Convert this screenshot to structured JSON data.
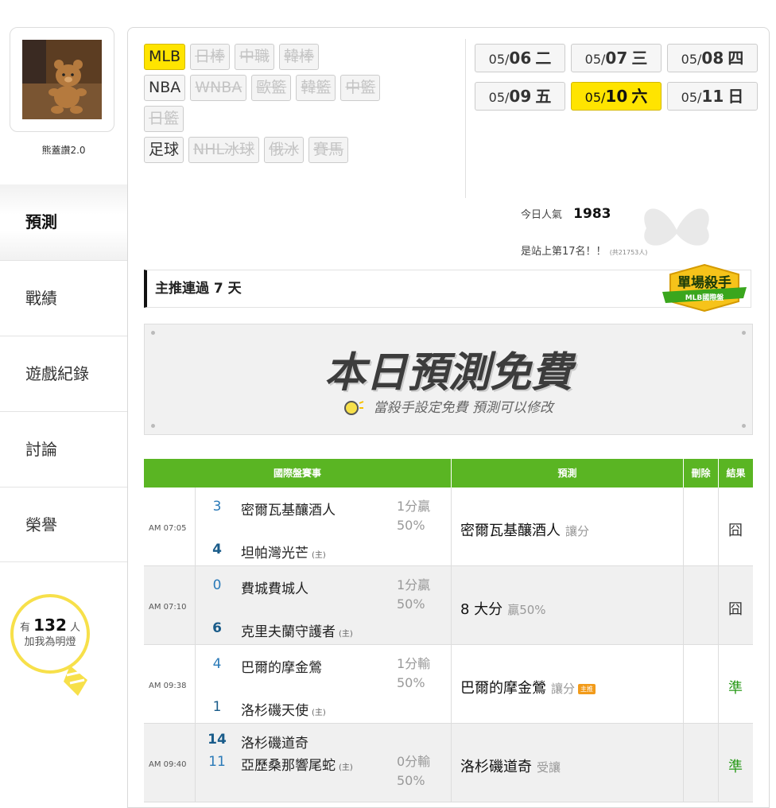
{
  "user": {
    "name": "熊蓋讚2.0"
  },
  "sidebar": {
    "items": [
      {
        "label": "預測",
        "active": true
      },
      {
        "label": "戰績"
      },
      {
        "label": "遊戲紀錄"
      },
      {
        "label": "討論"
      },
      {
        "label": "榮譽"
      }
    ],
    "fans": {
      "prefix": "有",
      "count": "132",
      "suffix": "人",
      "label": "加我為明燈"
    }
  },
  "leagues": {
    "row1": [
      {
        "label": "MLB",
        "state": "on"
      },
      {
        "label": "日棒",
        "state": "dim"
      },
      {
        "label": "中職",
        "state": "dim"
      },
      {
        "label": "韓棒",
        "state": "dim"
      }
    ],
    "row2": [
      {
        "label": "NBA",
        "state": "normal"
      },
      {
        "label": "WNBA",
        "state": "dim"
      },
      {
        "label": "歐籃",
        "state": "dim"
      },
      {
        "label": "韓籃",
        "state": "dim"
      },
      {
        "label": "中籃",
        "state": "dim"
      }
    ],
    "row3": [
      {
        "label": "日籃",
        "state": "dim"
      }
    ],
    "row4": [
      {
        "label": "足球",
        "state": "normal"
      },
      {
        "label": "NHL冰球",
        "state": "dim"
      },
      {
        "label": "俄冰",
        "state": "dim"
      },
      {
        "label": "賽馬",
        "state": "dim"
      }
    ]
  },
  "dates": [
    {
      "month": "05/",
      "day": "06",
      "weekday": "二"
    },
    {
      "month": "05/",
      "day": "07",
      "weekday": "三"
    },
    {
      "month": "05/",
      "day": "08",
      "weekday": "四"
    },
    {
      "month": "05/",
      "day": "09",
      "weekday": "五"
    },
    {
      "month": "05/",
      "day": "10",
      "weekday": "六",
      "selected": true
    },
    {
      "month": "05/",
      "day": "11",
      "weekday": "日"
    }
  ],
  "stats": {
    "popularity_label": "今日人氣",
    "popularity_value": "1983",
    "rank_text": "是站上第17名！！",
    "rank_total": "(共21753人)"
  },
  "streak": {
    "text": "主推連過 7 天"
  },
  "badge": {
    "title": "單場殺手",
    "subtitle": "MLB國際盤"
  },
  "free_banner": {
    "title": "本日預測免費",
    "subtitle": "當殺手設定免費 預測可以修改"
  },
  "table": {
    "headers": {
      "match": "國際盤賽事",
      "prediction": "預測",
      "delete": "刪除",
      "result": "結果"
    },
    "home_marker": "(主)",
    "rows": [
      {
        "time": "AM 07:05",
        "away_score": "3",
        "away_team": "密爾瓦基釀酒人",
        "home_score": "4",
        "home_team": "坦帕灣光芒",
        "odds_line1": "1分贏",
        "odds_line2": "50%",
        "prediction": "密爾瓦基釀酒人",
        "prediction_extra": "讓分",
        "result": "囧",
        "result_color": "#333333"
      },
      {
        "time": "AM 07:10",
        "away_score": "0",
        "away_team": "費城費城人",
        "home_score": "6",
        "home_team": "克里夫蘭守護者",
        "odds_line1": "1分贏",
        "odds_line2": "50%",
        "prediction": "8 大分",
        "prediction_extra": "贏50%",
        "result": "囧",
        "result_color": "#333333"
      },
      {
        "time": "AM 09:38",
        "away_score": "4",
        "away_team": "巴爾的摩金鶯",
        "home_score": "1",
        "home_team": "洛杉磯天使",
        "odds_line1": "1分輸",
        "odds_line2": "50%",
        "prediction": "巴爾的摩金鶯",
        "prediction_extra": "讓分",
        "prediction_tag": "主推",
        "result": "準",
        "result_color": "#2a9a1a"
      },
      {
        "time": "AM 09:40",
        "away_score": "14",
        "away_team": "洛杉磯道奇",
        "home_score": "11",
        "home_team": "亞歷桑那響尾蛇",
        "odds_line1": "0分輸",
        "odds_line2": "50%",
        "prediction": "洛杉磯道奇",
        "prediction_extra": "受讓",
        "result": "準",
        "result_color": "#2a9a1a"
      }
    ]
  }
}
